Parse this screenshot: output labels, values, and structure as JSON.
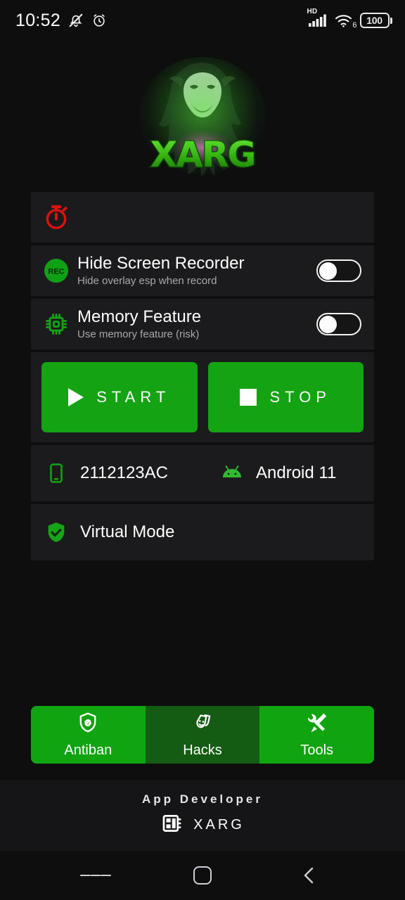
{
  "status_bar": {
    "time": "10:52",
    "icons": [
      "mute-icon",
      "alarm-icon"
    ],
    "network_label": "HD",
    "wifi_generation": "6",
    "battery_level": "100"
  },
  "branding": {
    "logo_alt": "XARG",
    "logo_text": "XARG"
  },
  "timer_card": {
    "icon": "stopwatch-icon",
    "icon_color": "#e01010"
  },
  "settings": [
    {
      "icon": "rec-icon",
      "title": "Hide Screen Recorder",
      "subtitle": "Hide overlay esp when record",
      "toggle_state": "off"
    },
    {
      "icon": "cpu-chip-icon",
      "title": "Memory Feature",
      "subtitle": "Use memory feature (risk)",
      "toggle_state": "off"
    }
  ],
  "actions": {
    "start_label": "START",
    "start_icon": "play-icon",
    "stop_label": "STOP",
    "stop_icon": "stop-icon",
    "button_color": "#13a313"
  },
  "device_info": {
    "device_icon": "smartphone-icon",
    "device_model": "2112123AC",
    "os_icon": "android-icon",
    "os_version": "Android 11"
  },
  "mode": {
    "icon": "shield-check-icon",
    "label": "Virtual Mode"
  },
  "bottom_nav": [
    {
      "icon": "shield-link-icon",
      "label": "Antiban",
      "selected": false
    },
    {
      "icon": "theater-masks-icon",
      "label": "Hacks",
      "selected": true
    },
    {
      "icon": "tools-icon",
      "label": "Tools",
      "selected": false
    }
  ],
  "footer": {
    "title": "App Developer",
    "icon": "chip-grid-icon",
    "name": "XARG"
  },
  "system_nav": {
    "recents": "menu-icon",
    "home": "home-icon",
    "back": "back-icon"
  },
  "colors": {
    "accent_green": "#13a313",
    "selected_green": "#145c14",
    "page_bg": "#0e0e0f",
    "card_bg": "#1b1b1d",
    "danger_red": "#e01010"
  }
}
